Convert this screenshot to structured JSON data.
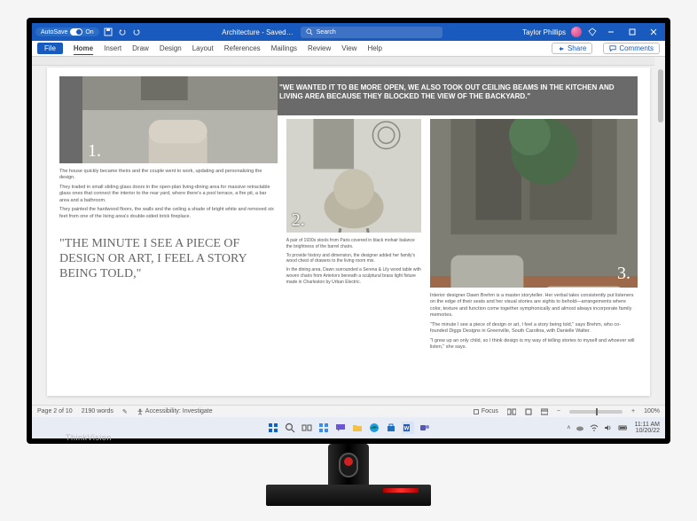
{
  "titlebar": {
    "autosave_label": "AutoSave",
    "autosave_state": "On",
    "doc_title": "Architecture - Saved…",
    "search_placeholder": "Search",
    "user_name": "Taylor Phillips"
  },
  "ribbon": {
    "file": "File",
    "tabs": [
      "Home",
      "Insert",
      "Draw",
      "Design",
      "Layout",
      "References",
      "Mailings",
      "Review",
      "View",
      "Help"
    ],
    "share": "Share",
    "comments": "Comments"
  },
  "document": {
    "banner_quote": "\"WE WANTED IT TO BE MORE OPEN, WE ALSO TOOK OUT CEILING BEAMS IN THE KITCHEN AND LIVING AREA BECAUSE THEY BLOCKED THE VIEW OF THE BACKYARD.\"",
    "num1": "1.",
    "num2": "2.",
    "num3": "3.",
    "col1": {
      "p1": "The house quickly became theirs and the couple went to work, updating and personalizing the design.",
      "p2": "They traded in small sliding glass doors in the open-plan living-dining area for massive retractable glass ones that connect the interior to the rear yard, where there's a pool terrace, a fire pit, a bar area and a bathroom.",
      "p3": "They painted the hardwood floors, the walls and the ceiling a shade of bright white and removed six feet from one of the living area's double-sided brick fireplace.",
      "pull_quote": "\"THE MINUTE I SEE A PIECE OF DESIGN OR ART, I FEEL A STORY BEING TOLD,\""
    },
    "col2": {
      "p1": "A pair of 1930s stools from Paris covered in black mohair balance the brightness of the barrel chairs.",
      "p2": "To provide history and dimension, the designer added her family's wood chest of drawers to the living room mix.",
      "p3": "In the dining area, Dawn surrounded a Serena & Lily wood table with woven chairs from Arteriors beneath a sculptural brass light fixture made in Charleston by Urban Electric."
    },
    "col3": {
      "p1": "Interior designer Dawn Brehm is a master storyteller. Her verbal tales consistently put listeners on the edge of their seats and her visual stories are sights to behold—arrangements where color, texture and function come together symphonically and almost always incorporate family memories.",
      "p2": "\"The minute I see a piece of design or art, I feel a story being told,\" says Brehm, who co-founded Diggs Designs in Greenville, South Carolina, with Danielle Walter.",
      "p3": "\"I grew up an only child, so I think design is my way of telling stories to myself and whoever will listen,\" she says."
    }
  },
  "statusbar": {
    "page_info": "Page 2 of 10",
    "word_count": "2190 words",
    "accessibility": "Accessibility: Investigate",
    "focus": "Focus",
    "zoom": "100%"
  },
  "taskbar": {
    "time": "11:11 AM",
    "date": "10/20/22"
  },
  "monitor": {
    "brand": "ThinkVision"
  }
}
